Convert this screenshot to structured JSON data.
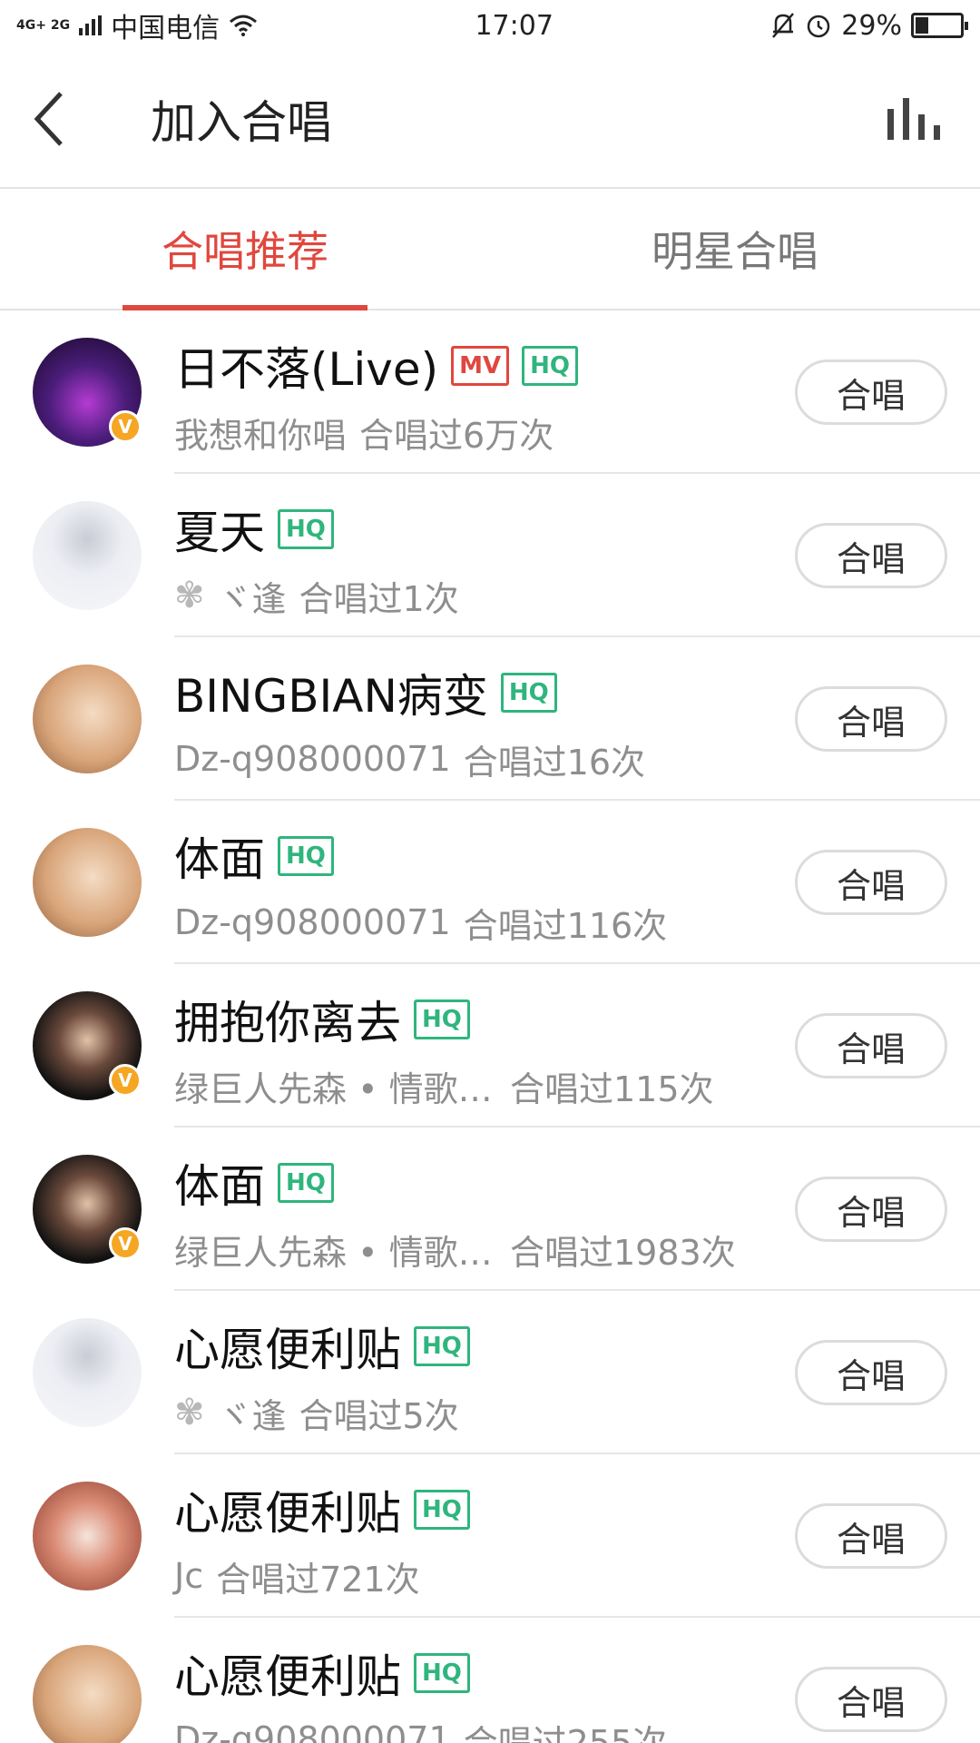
{
  "status_bar": {
    "network": "4G+ 2G",
    "carrier": "中国电信",
    "time": "17:07",
    "battery": "29%",
    "battery_level": 0.29
  },
  "header": {
    "title": "加入合唱",
    "back_icon": "chevron-left-icon",
    "chart_icon": "bar-chart-icon"
  },
  "tabs": [
    {
      "label": "合唱推荐",
      "active": true
    },
    {
      "label": "明星合唱",
      "active": false
    }
  ],
  "colors": {
    "accent": "#e0473e",
    "hq_tag": "#2fb57d",
    "vip_badge": "#f5a623"
  },
  "items": [
    {
      "title": "日不落(Live)",
      "mv": "MV",
      "hq": "HQ",
      "author": "我想和你唱",
      "count": "合唱过6万次",
      "button": "合唱",
      "verified": "V"
    },
    {
      "title": "夏天",
      "hq": "HQ",
      "flower": "✾",
      "author": "ヾ逢",
      "count": "合唱过1次",
      "button": "合唱"
    },
    {
      "title": "BINGBIAN病变",
      "hq": "HQ",
      "author": "Dz-q908000071",
      "count": "合唱过16次",
      "button": "合唱"
    },
    {
      "title": "体面",
      "hq": "HQ",
      "author": "Dz-q908000071",
      "count": "合唱过116次",
      "button": "合唱"
    },
    {
      "title": "拥抱你离去",
      "hq": "HQ",
      "author": "绿巨人先森 • 情歌…",
      "count": "合唱过115次",
      "button": "合唱",
      "verified": "V"
    },
    {
      "title": "体面",
      "hq": "HQ",
      "author": "绿巨人先森 • 情歌…",
      "count": "合唱过1983次",
      "button": "合唱",
      "verified": "V"
    },
    {
      "title": "心愿便利贴",
      "hq": "HQ",
      "flower": "✾",
      "author": "ヾ逢",
      "count": "合唱过5次",
      "button": "合唱"
    },
    {
      "title": "心愿便利贴",
      "hq": "HQ",
      "author": "Jc",
      "count": "合唱过721次",
      "button": "合唱"
    },
    {
      "title": "心愿便利贴",
      "hq": "HQ",
      "author": "Dz-q908000071",
      "count": "合唱过255次",
      "button": "合唱"
    }
  ]
}
